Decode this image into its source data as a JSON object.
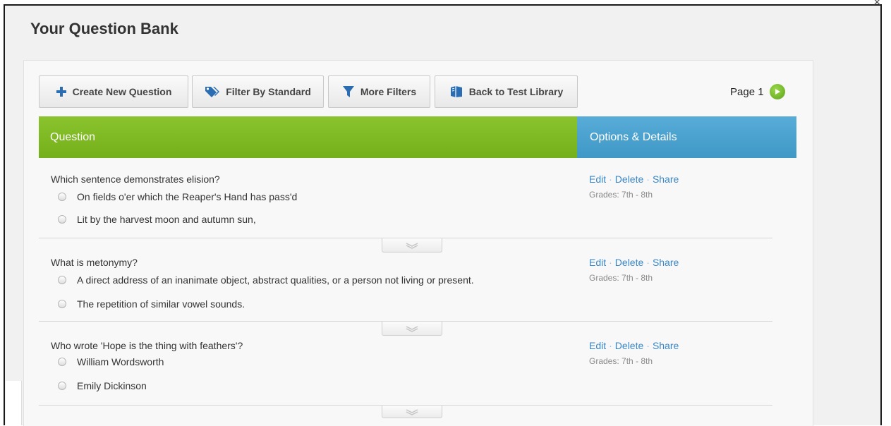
{
  "modal": {
    "title": "Your Question Bank",
    "close_glyph": "×"
  },
  "toolbar": {
    "create_label": "Create New Question",
    "filter_standard_label": "Filter By Standard",
    "more_filters_label": "More Filters",
    "back_label": "Back to Test Library",
    "page_label": "Page 1"
  },
  "table": {
    "header_question": "Question",
    "header_options": "Options & Details"
  },
  "questions": [
    {
      "text": "Which sentence demonstrates elision?",
      "options": [
        "On fields o'er which the Reaper's Hand has pass'd",
        "Lit by the harvest moon and autumn sun,"
      ],
      "actions": {
        "edit": "Edit",
        "delete": "Delete",
        "share": "Share",
        "sep": "·"
      },
      "grades": "Grades: 7th - 8th"
    },
    {
      "text": "What is metonymy?",
      "options": [
        "A direct address of an inanimate object, abstract qualities, or a person not living or present.",
        "The repetition of similar vowel sounds."
      ],
      "actions": {
        "edit": "Edit",
        "delete": "Delete",
        "share": "Share",
        "sep": "·"
      },
      "grades": "Grades: 7th - 8th"
    },
    {
      "text": "Who wrote 'Hope is the thing with feathers'?",
      "options": [
        "William Wordsworth",
        "Emily Dickinson"
      ],
      "actions": {
        "edit": "Edit",
        "delete": "Delete",
        "share": "Share",
        "sep": "·"
      },
      "grades": "Grades: 7th - 8th"
    }
  ],
  "colors": {
    "question_header": "#7cb823",
    "options_header": "#4aa3d1",
    "link": "#3a87c8",
    "page_next": "#6fb42a"
  },
  "icons": {
    "create": "plus-icon",
    "filter_standard": "tags-icon",
    "more_filters": "funnel-icon",
    "back": "book-icon",
    "page_next": "play-icon",
    "expand": "chevron-down-icon"
  }
}
